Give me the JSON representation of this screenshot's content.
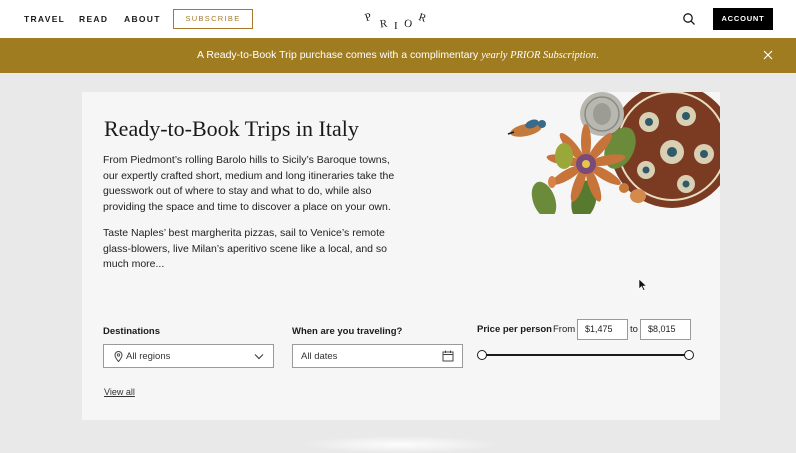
{
  "nav": {
    "links": [
      "TRAVEL",
      "READ",
      "ABOUT"
    ],
    "subscribe": "SUBSCRIBE",
    "logo": "PRIOR",
    "account": "ACCOUNT"
  },
  "banner": {
    "text": "A Ready-to-Book Trip purchase comes with a complimentary",
    "italic": "yearly PRIOR Subscription",
    "end": "."
  },
  "hero": {
    "title": "Ready-to-Book Trips in Italy",
    "paragraph1": "From Piedmont’s rolling Barolo hills to Sicily’s Baroque towns, our expertly crafted short, medium and long itineraries take the guesswork out of where to stay and what to do, while also providing the space and time to discover a place on your own.",
    "paragraph2": "Taste Naples’ best margherita pizzas, sail to Venice’s remote glass-blowers, live Milan’s aperitivo scene like a local, and so much more..."
  },
  "filters": {
    "destinations_label": "Destinations",
    "destinations_value": "All regions",
    "dates_label": "When are you traveling?",
    "dates_value": "All dates",
    "price_label": "Price per person",
    "from_label": "From",
    "to_label": "to",
    "price_min": "$1,475",
    "price_max": "$8,015",
    "view_all": "View all"
  },
  "colors": {
    "accent_gold": "#a07c20",
    "black": "#000000"
  },
  "icons": [
    "search-icon",
    "close-icon",
    "location-pin-icon",
    "chevron-down-icon",
    "calendar-icon"
  ]
}
